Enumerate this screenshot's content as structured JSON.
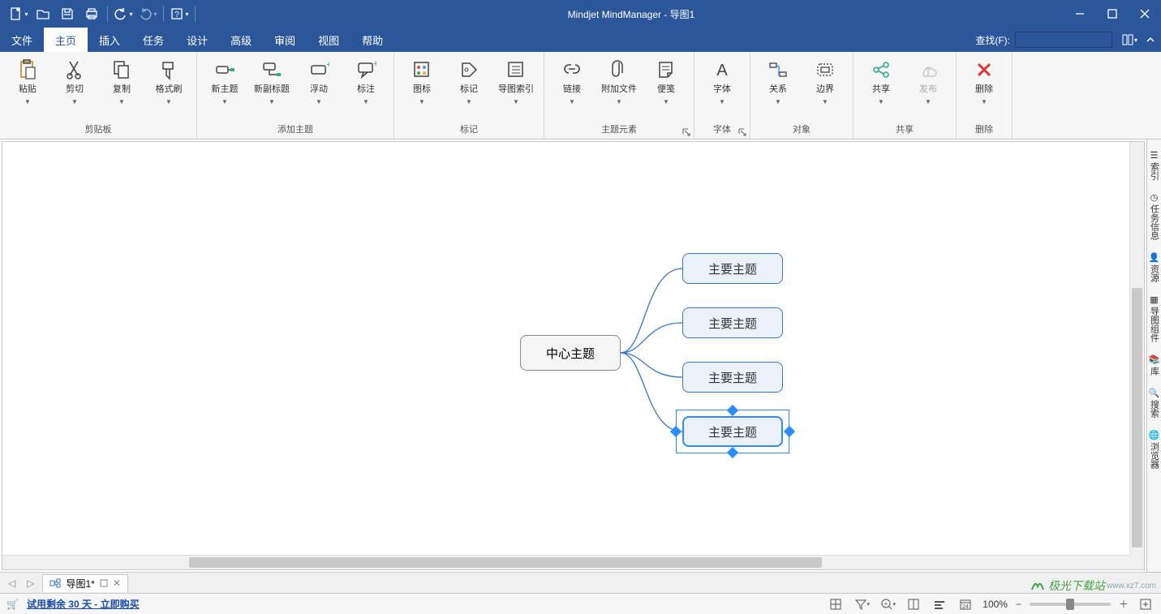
{
  "app": {
    "title": "Mindjet MindManager - 导图1"
  },
  "menus": {
    "items": [
      {
        "label": "文件"
      },
      {
        "label": "主页"
      },
      {
        "label": "插入"
      },
      {
        "label": "任务"
      },
      {
        "label": "设计"
      },
      {
        "label": "高级"
      },
      {
        "label": "审阅"
      },
      {
        "label": "视图"
      },
      {
        "label": "帮助"
      }
    ],
    "active_index": 1,
    "find_label": "查找(F):"
  },
  "ribbon": {
    "groups": [
      {
        "name": "剪贴板",
        "buttons": [
          {
            "label": "粘贴",
            "icon": "paste-icon"
          },
          {
            "label": "剪切",
            "icon": "cut-icon"
          },
          {
            "label": "复制",
            "icon": "copy-icon"
          },
          {
            "label": "格式刷",
            "icon": "format-painter-icon"
          }
        ]
      },
      {
        "name": "添加主题",
        "buttons": [
          {
            "label": "新主题",
            "icon": "new-topic-icon"
          },
          {
            "label": "新副标题",
            "icon": "new-subtopic-icon"
          },
          {
            "label": "浮动",
            "icon": "floating-icon"
          },
          {
            "label": "标注",
            "icon": "callout-icon"
          }
        ]
      },
      {
        "name": "标记",
        "buttons": [
          {
            "label": "图标",
            "icon": "markers-icon"
          },
          {
            "label": "标记",
            "icon": "tag-icon"
          },
          {
            "label": "导图索引",
            "icon": "index-icon"
          }
        ]
      },
      {
        "name": "主题元素",
        "buttons": [
          {
            "label": "链接",
            "icon": "link-icon"
          },
          {
            "label": "附加文件",
            "icon": "attach-icon"
          },
          {
            "label": "便笺",
            "icon": "note-icon"
          }
        ],
        "launcher": true
      },
      {
        "name": "字体",
        "buttons": [
          {
            "label": "字体",
            "icon": "font-icon"
          }
        ],
        "launcher": true
      },
      {
        "name": "对象",
        "buttons": [
          {
            "label": "关系",
            "icon": "relationship-icon"
          },
          {
            "label": "边界",
            "icon": "boundary-icon"
          }
        ]
      },
      {
        "name": "共享",
        "buttons": [
          {
            "label": "共享",
            "icon": "share-icon"
          },
          {
            "label": "发布",
            "icon": "publish-icon",
            "disabled": true
          }
        ]
      },
      {
        "name": "删除",
        "buttons": [
          {
            "label": "删除",
            "icon": "delete-icon"
          }
        ]
      }
    ]
  },
  "mindmap": {
    "center": "中心主题",
    "topics": [
      "主要主题",
      "主要主题",
      "主要主题",
      "主要主题"
    ],
    "selected_index": 3
  },
  "sidepanel": {
    "tabs": [
      {
        "label": "索引",
        "icon": "index-side-icon"
      },
      {
        "label": "任务信息",
        "icon": "task-side-icon"
      },
      {
        "label": "资源",
        "icon": "resource-side-icon"
      },
      {
        "label": "导图组件",
        "icon": "component-side-icon"
      },
      {
        "label": "库",
        "icon": "library-side-icon"
      },
      {
        "label": "搜索",
        "icon": "search-side-icon"
      },
      {
        "label": "浏览器",
        "icon": "browser-side-icon"
      }
    ]
  },
  "tabstrip": {
    "doc_label": "导图1*"
  },
  "statusbar": {
    "trial": "试用剩余 30 天 - 立即购买",
    "zoom": "100%"
  },
  "watermark": {
    "brand": "极光下载站",
    "url": "www.xz7.com"
  }
}
